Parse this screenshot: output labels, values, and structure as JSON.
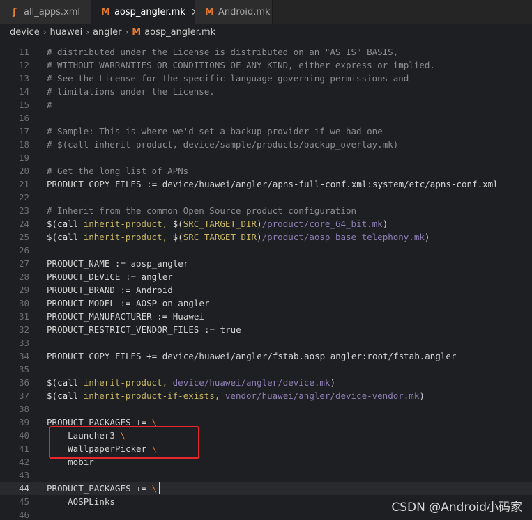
{
  "tabs": [
    {
      "label": "all_apps.xml",
      "icon": "rss-icon",
      "active": false
    },
    {
      "label": "aosp_angler.mk",
      "icon": "makefile-icon",
      "active": true,
      "closable": true
    },
    {
      "label": "Android.mk",
      "icon": "makefile-icon",
      "active": false
    }
  ],
  "icons": {
    "rss": "ʃ",
    "makefile": "M",
    "close": "✕",
    "chevron": "›"
  },
  "breadcrumb": [
    "device",
    "huawei",
    "angler",
    "aosp_angler.mk"
  ],
  "editor": {
    "current_line": 44,
    "lines": [
      {
        "n": 11,
        "text": "# distributed under the License is distributed on an \"AS IS\" BASIS,"
      },
      {
        "n": 12,
        "text": "# WITHOUT WARRANTIES OR CONDITIONS OF ANY KIND, either express or implied."
      },
      {
        "n": 13,
        "text": "# See the License for the specific language governing permissions and"
      },
      {
        "n": 14,
        "text": "# limitations under the License."
      },
      {
        "n": 15,
        "text": "#"
      },
      {
        "n": 16,
        "text": ""
      },
      {
        "n": 17,
        "text": "# Sample: This is where we'd set a backup provider if we had one"
      },
      {
        "n": 18,
        "text": "# $(call inherit-product, device/sample/products/backup_overlay.mk)"
      },
      {
        "n": 19,
        "text": ""
      },
      {
        "n": 20,
        "text": "# Get the long list of APNs"
      },
      {
        "n": 21,
        "text": "PRODUCT_COPY_FILES := device/huawei/angler/apns-full-conf.xml:system/etc/apns-conf.xml"
      },
      {
        "n": 22,
        "text": ""
      },
      {
        "n": 23,
        "text": "# Inherit from the common Open Source product configuration"
      },
      {
        "n": 24,
        "text": "$(call inherit-product, $(SRC_TARGET_DIR)/product/core_64_bit.mk)"
      },
      {
        "n": 25,
        "text": "$(call inherit-product, $(SRC_TARGET_DIR)/product/aosp_base_telephony.mk)"
      },
      {
        "n": 26,
        "text": ""
      },
      {
        "n": 27,
        "text": "PRODUCT_NAME := aosp_angler"
      },
      {
        "n": 28,
        "text": "PRODUCT_DEVICE := angler"
      },
      {
        "n": 29,
        "text": "PRODUCT_BRAND := Android"
      },
      {
        "n": 30,
        "text": "PRODUCT_MODEL := AOSP on angler"
      },
      {
        "n": 31,
        "text": "PRODUCT_MANUFACTURER := Huawei"
      },
      {
        "n": 32,
        "text": "PRODUCT_RESTRICT_VENDOR_FILES := true"
      },
      {
        "n": 33,
        "text": ""
      },
      {
        "n": 34,
        "text": "PRODUCT_COPY_FILES += device/huawei/angler/fstab.aosp_angler:root/fstab.angler"
      },
      {
        "n": 35,
        "text": ""
      },
      {
        "n": 36,
        "text": "$(call inherit-product, device/huawei/angler/device.mk)"
      },
      {
        "n": 37,
        "text": "$(call inherit-product-if-exists, vendor/huawei/angler/device-vendor.mk)"
      },
      {
        "n": 38,
        "text": ""
      },
      {
        "n": 39,
        "text": "PRODUCT_PACKAGES += \\"
      },
      {
        "n": 40,
        "text": "    Launcher3 \\"
      },
      {
        "n": 41,
        "text": "    WallpaperPicker \\"
      },
      {
        "n": 42,
        "text": "    mobir"
      },
      {
        "n": 43,
        "text": ""
      },
      {
        "n": 44,
        "text": "PRODUCT_PACKAGES += \\"
      },
      {
        "n": 45,
        "text": "    AOSPLinks"
      },
      {
        "n": 46,
        "text": ""
      }
    ]
  },
  "watermark": "CSDN @Android小码家",
  "colors": {
    "background": "#1e1f22",
    "comment": "#8b8d91",
    "function": "#c5b462",
    "path": "#8e7fb5",
    "backslash": "#e37933",
    "highlight_box": "#e8262d",
    "makefile_icon": "#e37933"
  }
}
